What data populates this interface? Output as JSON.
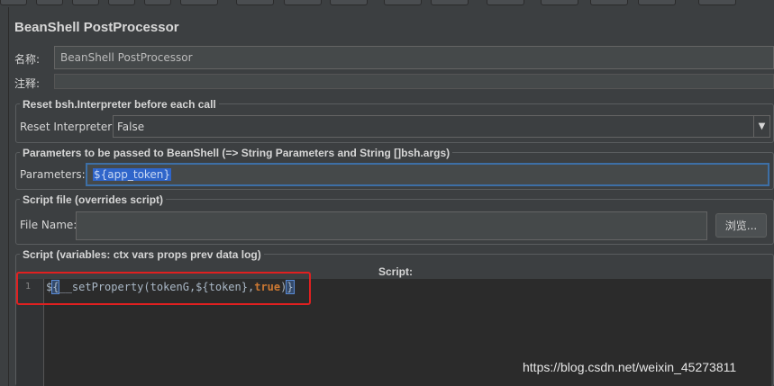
{
  "title": "BeanShell PostProcessor",
  "name_label": "名称:",
  "name_value": "BeanShell PostProcessor",
  "comment_label": "注释:",
  "reset_group": {
    "legend": "Reset bsh.Interpreter before each call",
    "label": "Reset Interpreter:",
    "value": "False",
    "arrow": "▼"
  },
  "params_group": {
    "legend": "Parameters to be passed to BeanShell (=> String Parameters and String []bsh.args)",
    "label": "Parameters:",
    "value": "${app_token}"
  },
  "script_file_group": {
    "legend": "Script file (overrides script)",
    "label": "File Name:",
    "value": "",
    "browse_button": "浏览..."
  },
  "script_group": {
    "legend": "Script (variables: ctx vars props prev data log)",
    "header": "Script:",
    "line_number": "1",
    "code_prefix": "$",
    "code_open_brace": "{",
    "code_body": "__setProperty(tokenG,${token},",
    "code_keyword": "true",
    "code_close_paren": ")",
    "code_close_brace": "}"
  },
  "watermark": "https://blog.csdn.net/weixin_45273811",
  "colors": {
    "background": "#3c3f41",
    "editor_bg": "#2b2b2b",
    "selection": "#2f65ca",
    "highlight_box": "#e02020",
    "keyword": "#cc7832"
  }
}
